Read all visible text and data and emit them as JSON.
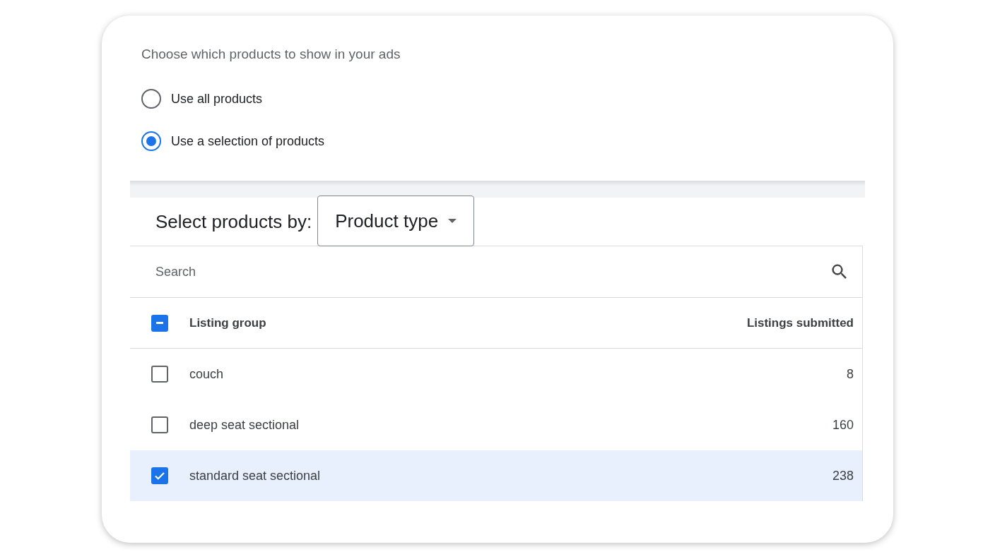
{
  "heading": "Choose which products to show in your ads",
  "options": [
    {
      "label": "Use all products",
      "selected": false
    },
    {
      "label": "Use a selection of products",
      "selected": true
    }
  ],
  "select_by": {
    "label": "Select products by:",
    "value": "Product type"
  },
  "search": {
    "placeholder": "Search"
  },
  "table": {
    "select_all": {
      "mixed": true
    },
    "columns": [
      "Listing group",
      "Listings submitted"
    ],
    "rows": [
      {
        "name": "couch",
        "count": "8",
        "selected": false
      },
      {
        "name": "deep seat sectional",
        "count": "160",
        "selected": false
      },
      {
        "name": "standard seat sectional",
        "count": "238",
        "selected": true
      }
    ]
  }
}
